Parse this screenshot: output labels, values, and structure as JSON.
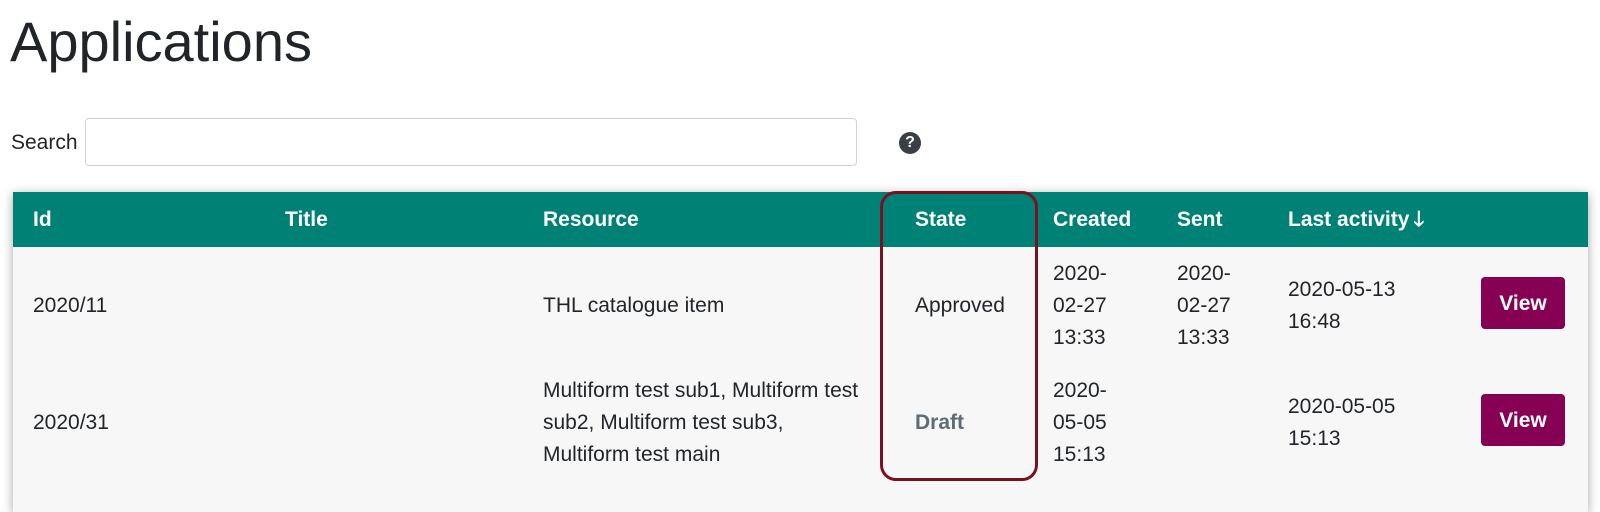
{
  "page": {
    "title": "Applications"
  },
  "search": {
    "label": "Search",
    "value": "",
    "placeholder": "",
    "help_icon": "question-circle-icon",
    "help_glyph": "?"
  },
  "table": {
    "header_color": "#008176",
    "columns": {
      "id": "Id",
      "title": "Title",
      "resource": "Resource",
      "state": "State",
      "created": "Created",
      "sent": "Sent",
      "last_activity": "Last activity",
      "sort_icon": "arrow-down-icon",
      "sort_glyph": "🡓"
    },
    "rows": [
      {
        "id": "2020/11",
        "title": "",
        "resource": [
          "THL catalogue item"
        ],
        "state": "Approved",
        "created": [
          "2020-",
          "02-27",
          "13:33"
        ],
        "sent": [
          "2020-",
          "02-27",
          "13:33"
        ],
        "last_activity": [
          "2020-05-13",
          "16:48"
        ],
        "action": "View"
      },
      {
        "id": "2020/31",
        "title": "",
        "resource": [
          "Multiform test sub1, Multiform test",
          "sub2, Multiform test sub3,",
          "Multiform test main"
        ],
        "state": "Draft",
        "created": [
          "2020-",
          "05-05",
          "15:13"
        ],
        "sent": [],
        "last_activity": [
          "2020-05-05",
          "15:13"
        ],
        "action": "View"
      }
    ]
  },
  "colors": {
    "accent": "#008176",
    "button": "#860054",
    "highlight": "#7a1020",
    "draft": "#5d6c79"
  }
}
